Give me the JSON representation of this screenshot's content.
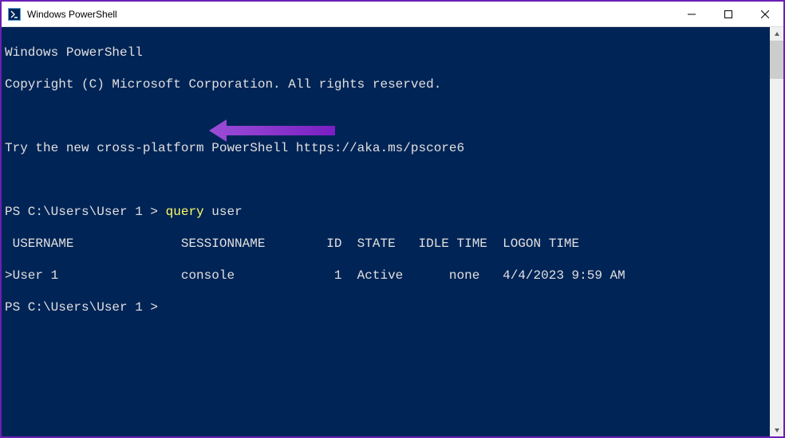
{
  "window": {
    "title": "Windows PowerShell"
  },
  "terminal": {
    "header1": "Windows PowerShell",
    "header2": "Copyright (C) Microsoft Corporation. All rights reserved.",
    "try_msg": "Try the new cross-platform PowerShell https://aka.ms/pscore6",
    "prompt1_prefix": "PS C:\\Users\\User 1 > ",
    "command_part1": "query",
    "command_part2": " user",
    "table_header": " USERNAME              SESSIONNAME        ID  STATE   IDLE TIME  LOGON TIME",
    "table_row": ">User 1                console             1  Active      none   4/4/2023 9:59 AM",
    "prompt2": "PS C:\\Users\\User 1 >"
  },
  "colors": {
    "terminal_bg": "#012456",
    "command_yellow": "#ffff66",
    "text": "#e0e0e0",
    "annotation": "#8a2be2"
  }
}
